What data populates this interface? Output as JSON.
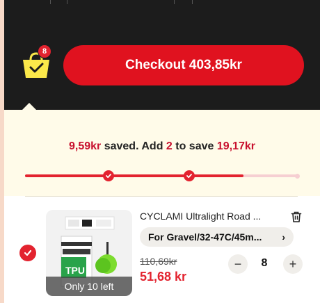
{
  "header": {
    "cart_count": "8",
    "checkout_label": "Checkout 403,85kr"
  },
  "savings": {
    "saved_amount": "9,59kr",
    "saved_text": " saved. Add ",
    "add_count": "2",
    "to_save_text": " to save ",
    "target_amount": "19,17kr"
  },
  "progress": {
    "fill_fraction": 0.8,
    "milestones_reached": 2
  },
  "item": {
    "title": "CYCLAMI Ultralight Road ...",
    "variant": "For Gravel/32-47C/45m...",
    "old_price": "110,69kr",
    "new_price": "51,68 kr",
    "quantity": "8",
    "stock_label": "Only 10 left",
    "selected": true
  },
  "colors": {
    "accent": "#e3232f",
    "header_bg": "#1c1c1c",
    "panel_bg": "#fffbe9"
  }
}
